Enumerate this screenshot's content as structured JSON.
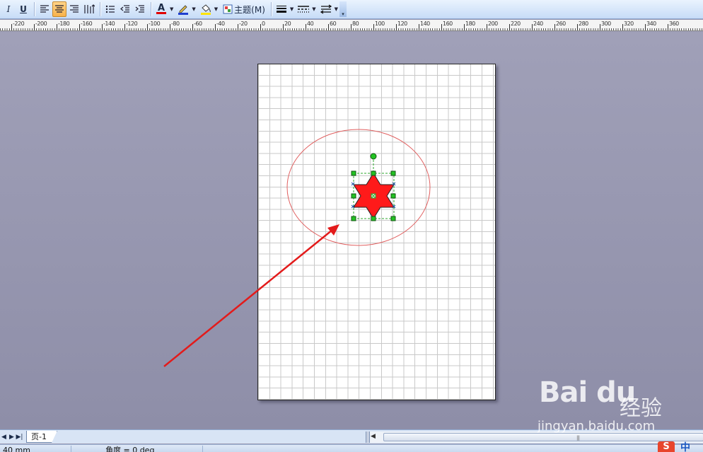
{
  "toolbar": {
    "italic_label": "I",
    "underline_label": "U",
    "theme_label": "主题(M)",
    "font_color_label": "A"
  },
  "ruler": {
    "labels": [
      "-220",
      "-200",
      "-180",
      "-160",
      "-140",
      "-120",
      "-100",
      "-80",
      "-60",
      "-40",
      "-20",
      "0",
      "20",
      "40",
      "60",
      "80",
      "100",
      "120",
      "140",
      "160",
      "180",
      "200",
      "220",
      "240",
      "260",
      "280",
      "300",
      "320",
      "340",
      "360"
    ]
  },
  "page_tabs": {
    "nav": [
      "◀",
      "▶",
      "▶|"
    ],
    "current": "页-1"
  },
  "status": {
    "width_readout": "40 mm",
    "angle_readout": "角度 = 0 deg"
  },
  "watermark": {
    "logo": "Bai du",
    "cn": "经验",
    "url": "jingyan.baidu.com"
  },
  "ime": {
    "brand": "S",
    "mode": "中"
  },
  "colors": {
    "star_fill": "#ff1a1a",
    "ellipse_stroke": "#e06060",
    "arrow": "#e31b1b",
    "handle_fill": "#22c322",
    "toolbar_active": "#f8b24a"
  }
}
